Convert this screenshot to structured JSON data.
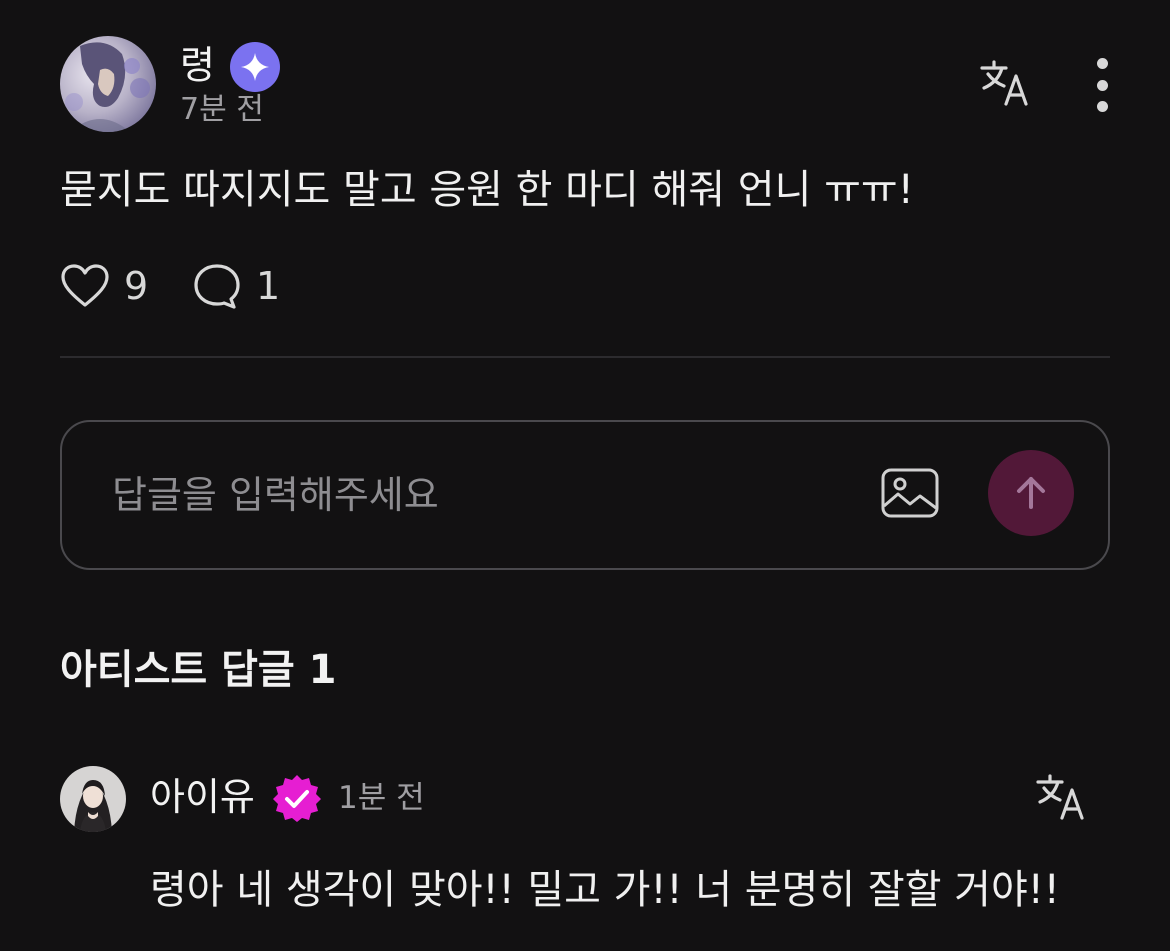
{
  "post": {
    "author_name": "령",
    "time": "7분 전",
    "body": "묻지도 따지지도 말고 응원 한 마디 해줘 언니 ㅠㅠ!",
    "like_count": "9",
    "comment_count": "1",
    "icons": [
      "star-badge-icon",
      "translate-icon",
      "more-vertical-icon",
      "heart-icon",
      "comment-icon"
    ]
  },
  "reply_input": {
    "placeholder": "답글을 입력해주세요",
    "icons": [
      "image-icon",
      "arrow-up-icon"
    ]
  },
  "artist_replies": {
    "title": "아티스트 답글 1",
    "items": [
      {
        "author_name": "아이유",
        "time": "1분 전",
        "body": "령아 네 생각이 맞아!! 밀고 가!! 너 분명히 잘할 거야!!",
        "icons": [
          "verified-icon",
          "translate-icon"
        ]
      }
    ]
  },
  "colors": {
    "background": "#121112",
    "star_badge": "#7b72f0",
    "verified_badge": "#e61ed2",
    "send_button": "#521838"
  }
}
